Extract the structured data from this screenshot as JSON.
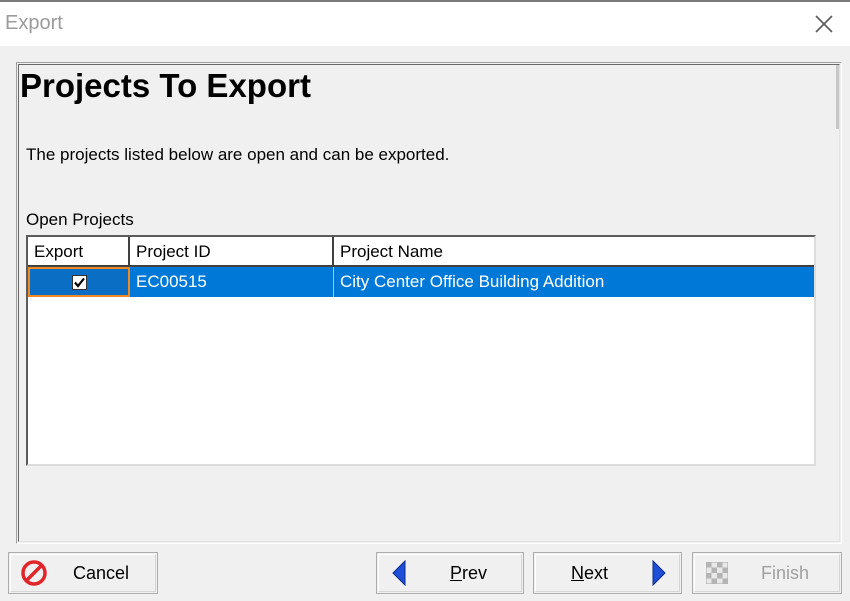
{
  "window": {
    "title": "Export"
  },
  "page": {
    "heading": "Projects To Export",
    "description": "The projects listed below are open and can be exported.",
    "group_label": "Open Projects"
  },
  "grid": {
    "columns": [
      "Export",
      "Project ID",
      "Project Name"
    ],
    "rows": [
      {
        "export": true,
        "project_id": "EC00515",
        "project_name": "City Center Office Building Addition"
      }
    ]
  },
  "buttons": {
    "cancel": "Cancel",
    "prev_mnemonic": "P",
    "prev_rest": "rev",
    "next_mnemonic": "N",
    "next_rest": "ext",
    "finish": "Finish"
  },
  "colors": {
    "selection": "#0078d7",
    "focus": "#f08a24",
    "nav_arrow": "#1f4fd6",
    "cancel_icon": "#e0262b"
  },
  "icons": {
    "close": "close-icon",
    "cancel": "no-entry-icon",
    "prev": "arrow-left-icon",
    "next": "arrow-right-icon",
    "finish": "checkered-flag-icon"
  }
}
